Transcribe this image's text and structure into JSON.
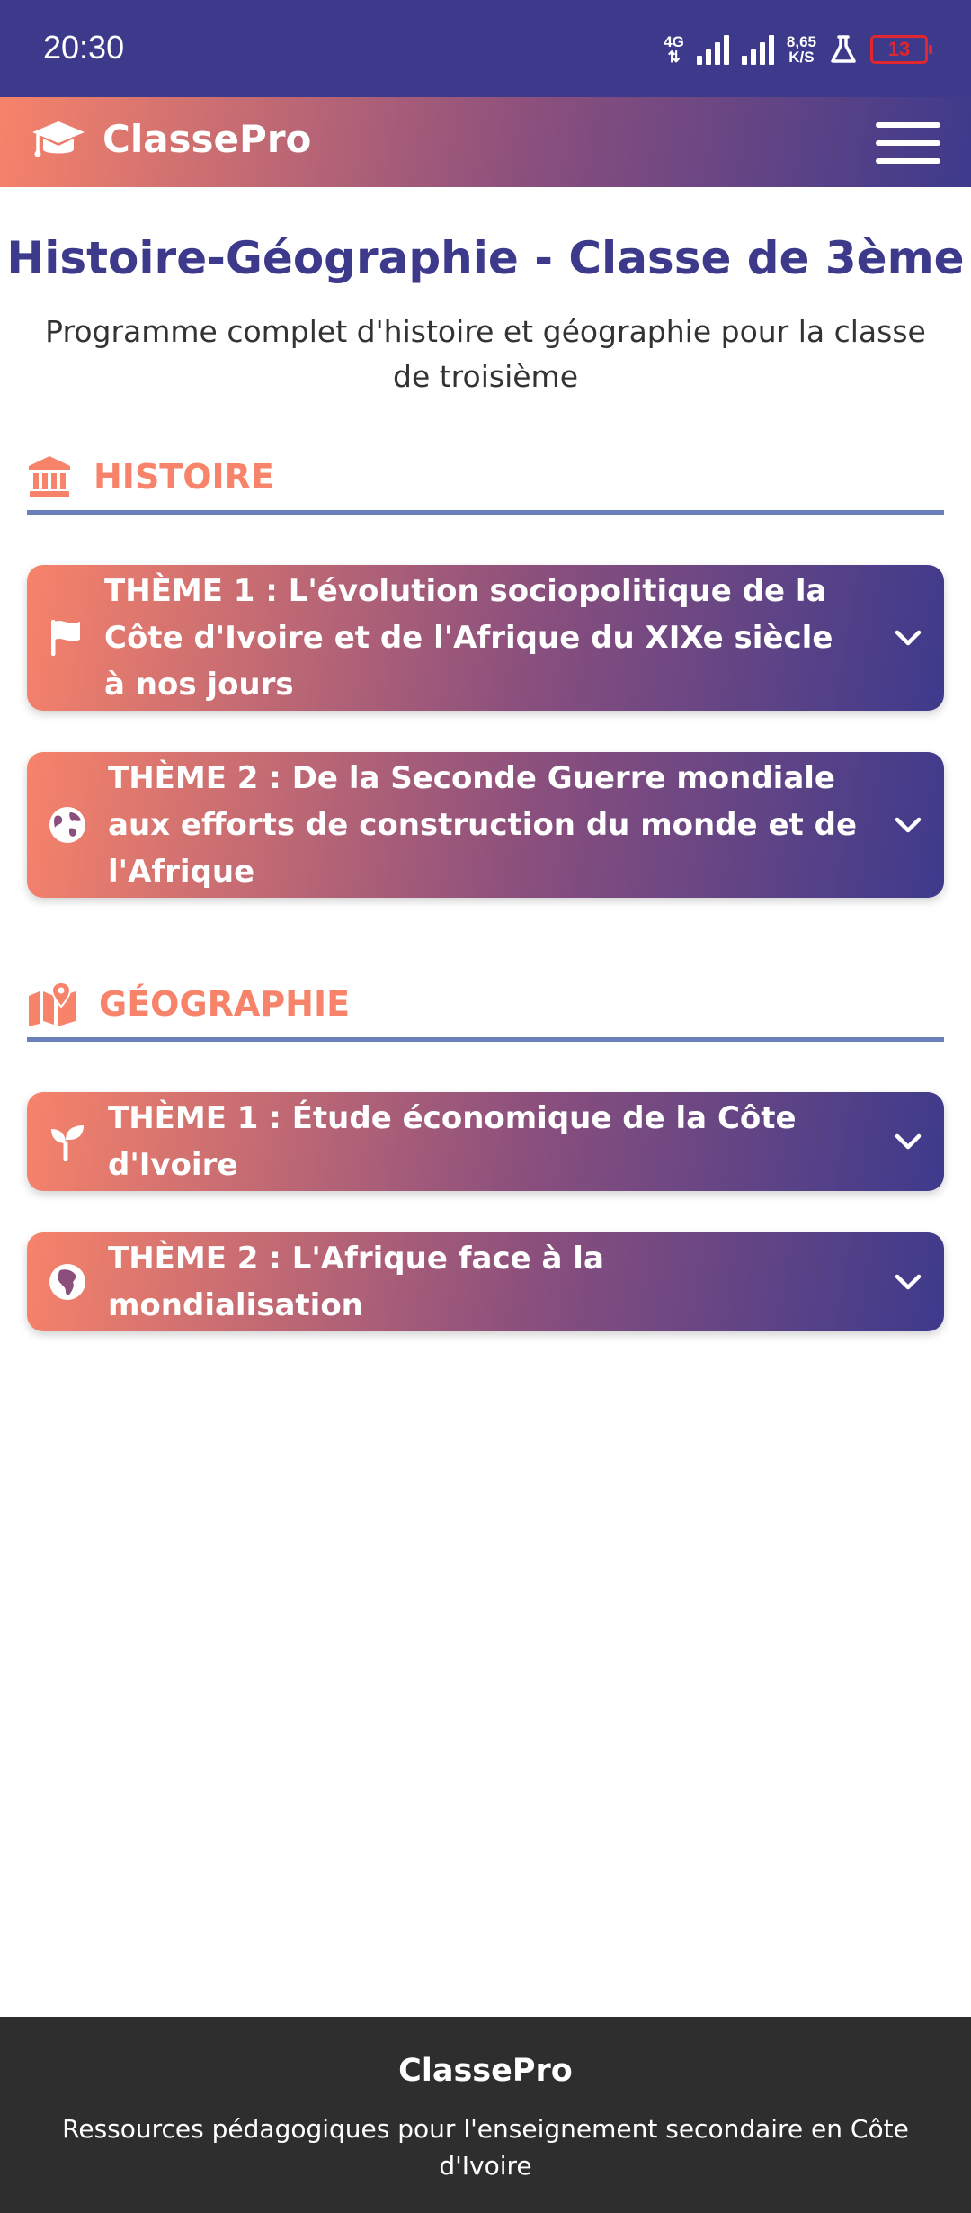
{
  "status_bar": {
    "time": "20:30",
    "network_type": "4G",
    "speed_value": "8,65",
    "speed_unit": "K/S",
    "battery_level": "13"
  },
  "app_header": {
    "brand": "ClassePro",
    "brand_icon": "graduation-cap-icon",
    "menu_icon": "hamburger-menu-icon"
  },
  "intro": {
    "title": "Histoire-Géographie - Classe de 3ème",
    "subtitle": "Programme complet d'histoire et géographie pour la classe de troisième"
  },
  "sections": {
    "histoire": {
      "label": "HISTOIRE",
      "icon": "landmark-icon",
      "themes": [
        {
          "label": "THÈME 1 : L'évolution sociopolitique de la Côte d'Ivoire et de l'Afrique du XIXe siècle à nos jours",
          "icon": "flag-icon"
        },
        {
          "label": "THÈME 2 : De la Seconde Guerre mondiale aux efforts de construction du monde et de l'Afrique",
          "icon": "globe-icon"
        }
      ]
    },
    "geographie": {
      "label": "GÉOGRAPHIE",
      "icon": "map-marked-icon",
      "themes": [
        {
          "label": "THÈME 1 : Étude économique de la Côte d'Ivoire",
          "icon": "seedling-icon"
        },
        {
          "label": "THÈME 2 : L'Afrique face à la mondialisation",
          "icon": "globe-africa-icon"
        }
      ]
    }
  },
  "footer": {
    "title": "ClassePro",
    "subtitle": "Ressources pédagogiques pour l'enseignement secondaire en Côte d'Ivoire"
  },
  "colors": {
    "primary": "#3d3a8c",
    "accent": "#f7836a",
    "divider": "#6b7fb8",
    "footer_bg": "#2e2e2e",
    "battery_warning": "#e0262e"
  }
}
